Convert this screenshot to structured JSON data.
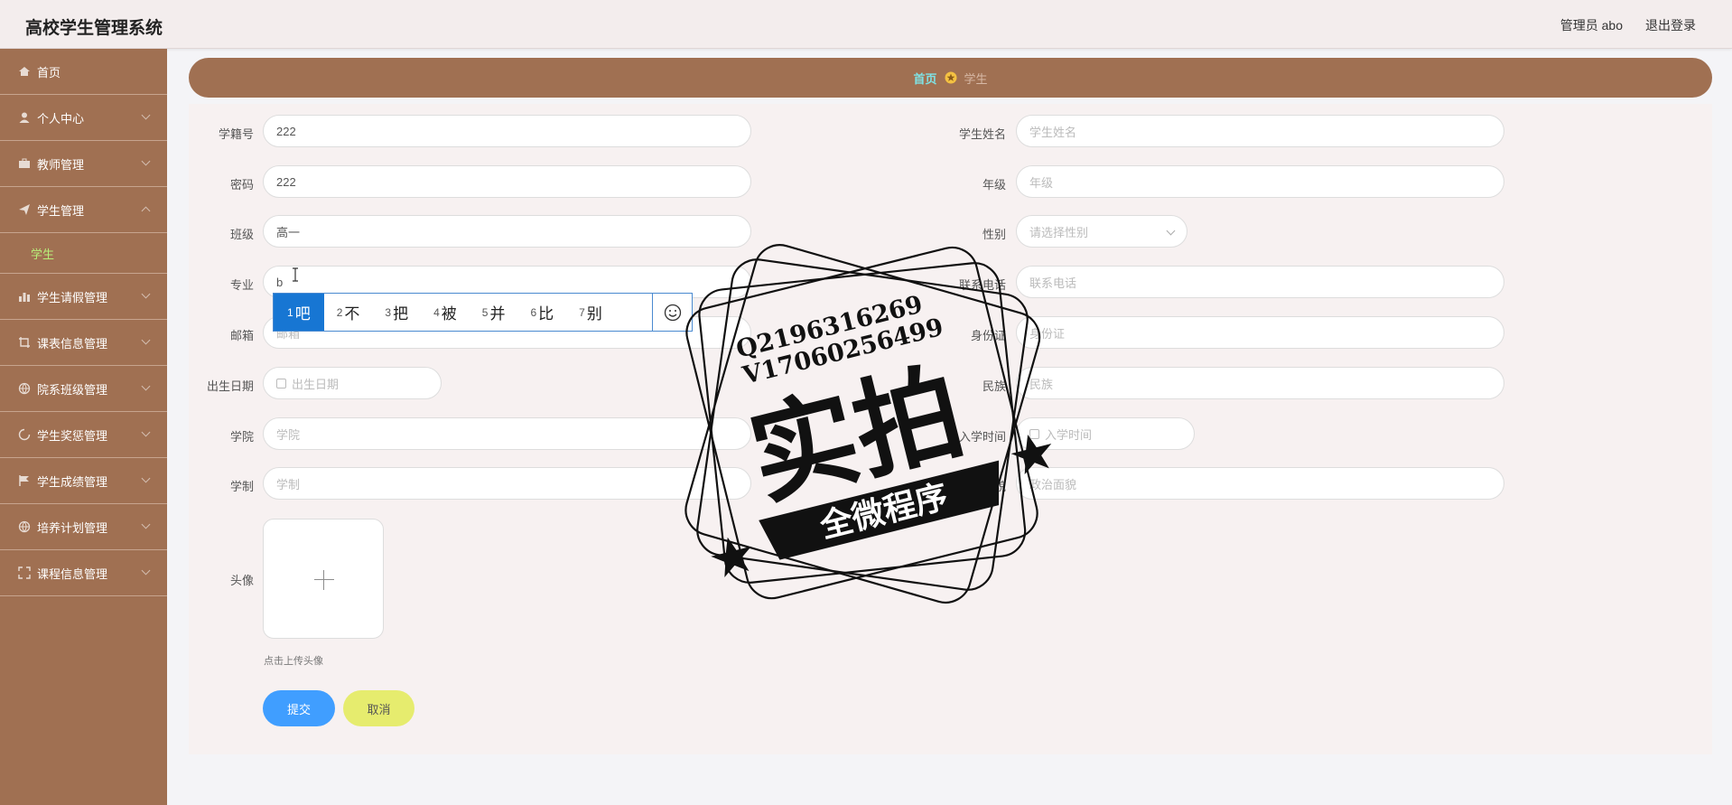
{
  "header": {
    "app_title": "高校学生管理系统",
    "admin_info": "管理员 abo",
    "logout_label": "退出登录"
  },
  "sidebar": {
    "items": [
      {
        "label": "首页",
        "icon": "home-icon",
        "has_arrow": false
      },
      {
        "label": "个人中心",
        "icon": "user-icon",
        "has_arrow": true
      },
      {
        "label": "教师管理",
        "icon": "briefcase-icon",
        "has_arrow": true
      },
      {
        "label": "学生管理",
        "icon": "send-icon",
        "has_arrow": true,
        "expanded": true,
        "sub": [
          {
            "label": "学生"
          }
        ]
      },
      {
        "label": "学生请假管理",
        "icon": "chart-icon",
        "has_arrow": true
      },
      {
        "label": "课表信息管理",
        "icon": "crop-icon",
        "has_arrow": true
      },
      {
        "label": "院系班级管理",
        "icon": "globe-icon",
        "has_arrow": true
      },
      {
        "label": "学生奖惩管理",
        "icon": "loading-icon",
        "has_arrow": true
      },
      {
        "label": "学生成绩管理",
        "icon": "flag-icon",
        "has_arrow": true
      },
      {
        "label": "培养计划管理",
        "icon": "globe-icon",
        "has_arrow": true
      },
      {
        "label": "课程信息管理",
        "icon": "fullscreen-icon",
        "has_arrow": true
      }
    ],
    "sub_active_color": "#b8f07a"
  },
  "breadcrumb": {
    "home": "首页",
    "current": "学生"
  },
  "form": {
    "student_id": {
      "label": "学籍号",
      "value": "222"
    },
    "student_name": {
      "label": "学生姓名",
      "placeholder": "学生姓名"
    },
    "password": {
      "label": "密码",
      "value": "222"
    },
    "grade": {
      "label": "年级",
      "placeholder": "年级"
    },
    "class": {
      "label": "班级",
      "value": "高一"
    },
    "gender": {
      "label": "性别",
      "placeholder": "请选择性别"
    },
    "major": {
      "label": "专业",
      "value": "b"
    },
    "phone": {
      "label": "联系电话",
      "placeholder": "联系电话"
    },
    "email": {
      "label": "邮箱",
      "placeholder": "邮箱"
    },
    "id_card": {
      "label": "身份证",
      "placeholder": "身份证"
    },
    "birth_date": {
      "label": "出生日期",
      "placeholder": "出生日期"
    },
    "ethnicity": {
      "label": "民族",
      "placeholder": "民族"
    },
    "college": {
      "label": "学院",
      "placeholder": "学院"
    },
    "enroll_time": {
      "label": "入学时间",
      "placeholder": "入学时间"
    },
    "schooling": {
      "label": "学制",
      "placeholder": "学制"
    },
    "political": {
      "label": "政治面貌",
      "placeholder": "政治面貌"
    },
    "avatar": {
      "label": "头像",
      "hint": "点击上传头像"
    },
    "submit_label": "提交",
    "cancel_label": "取消"
  },
  "ime": {
    "candidates": [
      {
        "num": "1",
        "char": "吧"
      },
      {
        "num": "2",
        "char": "不"
      },
      {
        "num": "3",
        "char": "把"
      },
      {
        "num": "4",
        "char": "被"
      },
      {
        "num": "5",
        "char": "并"
      },
      {
        "num": "6",
        "char": "比"
      },
      {
        "num": "7",
        "char": "别"
      }
    ],
    "emoji_icon": "emoji-icon"
  },
  "watermark": {
    "line1": "Q2196316269",
    "line2": "V17060256499",
    "big": "实拍",
    "banner": "全微程序"
  },
  "colors": {
    "brand": "#a07052",
    "primary": "#409eff",
    "cancel": "#e6ec6e",
    "crumb_home": "#7fe2e4"
  }
}
